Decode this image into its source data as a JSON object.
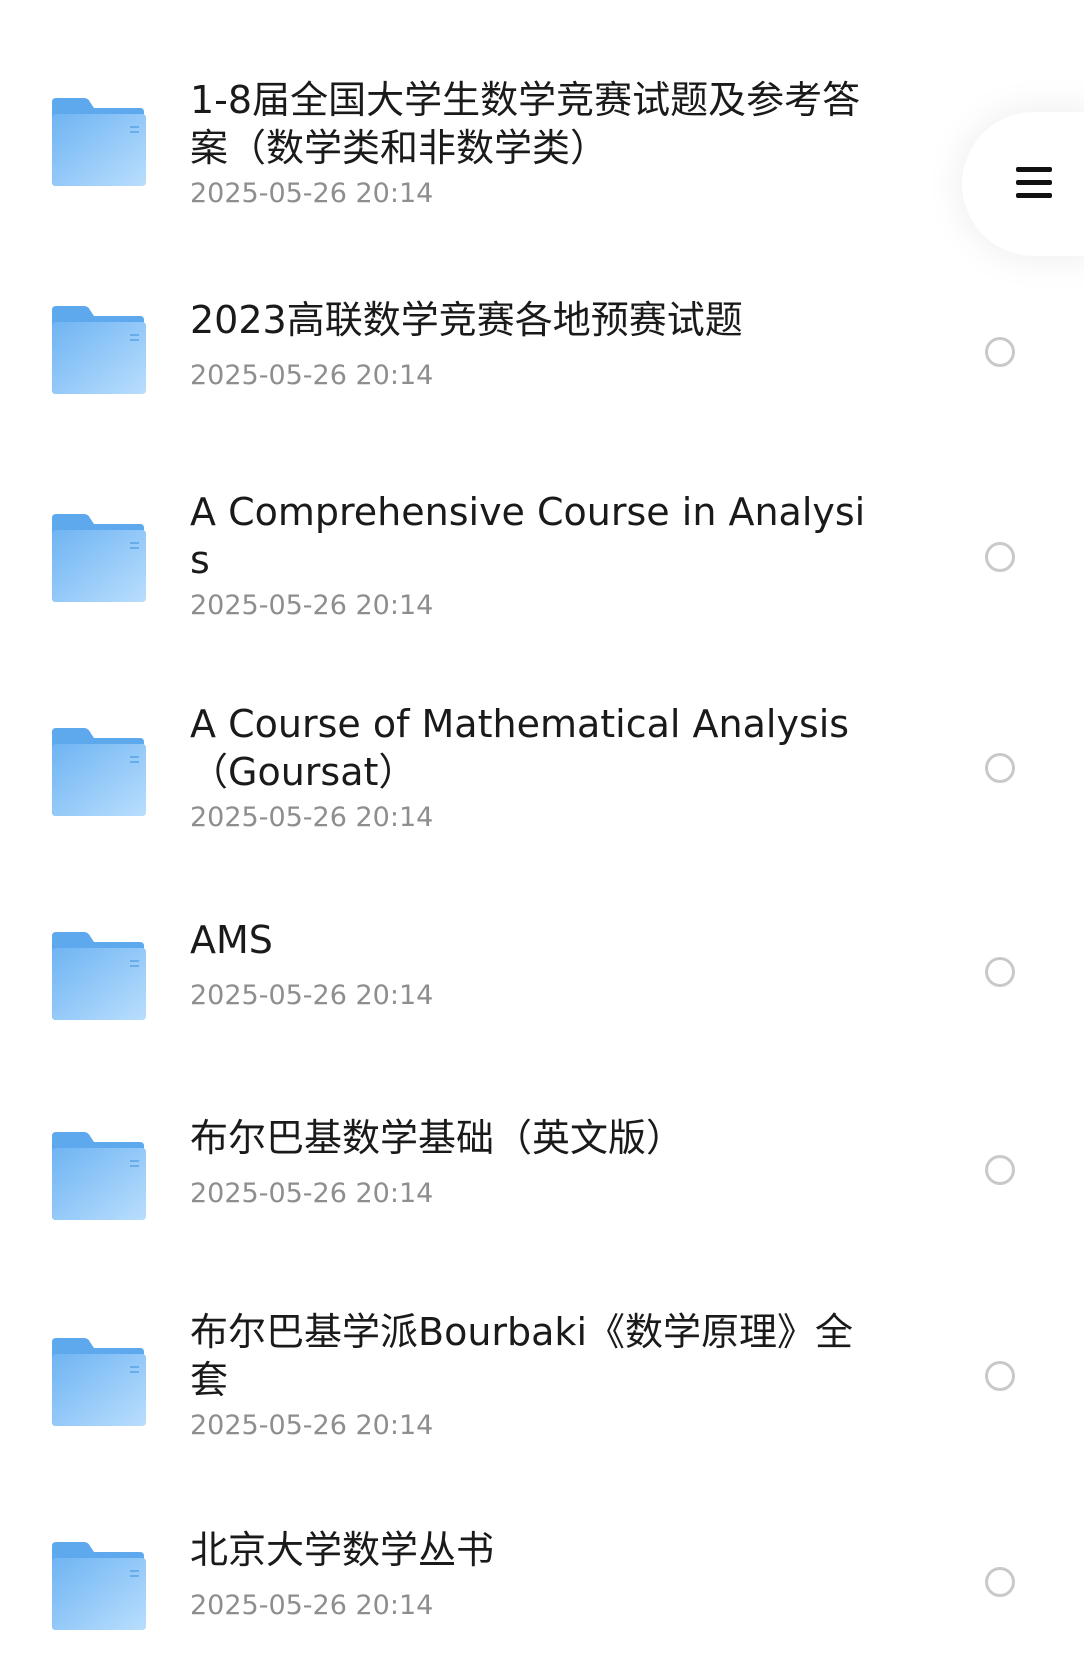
{
  "files": [
    {
      "name": "1-8届全国大学生数学竞赛试题及参考答案（数学类和非数学类）",
      "date": "2025-05-26 20:14",
      "icon": "folder-icon"
    },
    {
      "name": "2023高联数学竞赛各地预赛试题",
      "date": "2025-05-26 20:14",
      "icon": "folder-icon"
    },
    {
      "name": "A Comprehensive Course in Analysis",
      "date": "2025-05-26 20:14",
      "icon": "folder-icon"
    },
    {
      "name": " A Course of Mathematical Analysis（Goursat）",
      "date": "2025-05-26 20:14",
      "icon": "folder-icon"
    },
    {
      "name": "AMS",
      "date": "2025-05-26 20:14",
      "icon": "folder-icon"
    },
    {
      "name": "布尔巴基数学基础（英文版）",
      "date": "2025-05-26 20:14",
      "icon": "folder-icon"
    },
    {
      "name": "布尔巴基学派Bourbaki《数学原理》全套",
      "date": "2025-05-26 20:14",
      "icon": "folder-icon"
    },
    {
      "name": "北京大学数学丛书",
      "date": "2025-05-26 20:14",
      "icon": "folder-icon"
    }
  ],
  "menu": {
    "icon": "menu-icon"
  },
  "colors": {
    "folder_light": "#a9d5fb",
    "folder_dark": "#6fb4f3",
    "radio_border": "#c9c9c9",
    "date_text": "#8e8e8e"
  }
}
